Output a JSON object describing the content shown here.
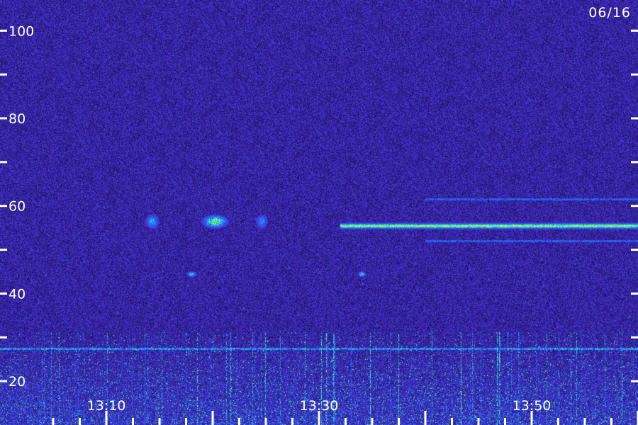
{
  "chart_data": {
    "type": "heatmap",
    "date_label": "06/16",
    "y_ticks": [
      {
        "value": 100,
        "label": "100"
      },
      {
        "value": 90,
        "label": ""
      },
      {
        "value": 80,
        "label": "80"
      },
      {
        "value": 70,
        "label": ""
      },
      {
        "value": 60,
        "label": "60"
      },
      {
        "value": 50,
        "label": ""
      },
      {
        "value": 40,
        "label": "40"
      },
      {
        "value": 30,
        "label": ""
      },
      {
        "value": 20,
        "label": "20"
      }
    ],
    "x_ticks": [
      {
        "minute": 5,
        "label": ""
      },
      {
        "minute": 7.5,
        "label": ""
      },
      {
        "minute": 10,
        "label": "13:10"
      },
      {
        "minute": 12.5,
        "label": ""
      },
      {
        "minute": 15,
        "label": ""
      },
      {
        "minute": 17.5,
        "label": ""
      },
      {
        "minute": 20,
        "label": ""
      },
      {
        "minute": 22.5,
        "label": ""
      },
      {
        "minute": 25,
        "label": ""
      },
      {
        "minute": 27.5,
        "label": ""
      },
      {
        "minute": 30,
        "label": "13:30"
      },
      {
        "minute": 32.5,
        "label": ""
      },
      {
        "minute": 35,
        "label": ""
      },
      {
        "minute": 37.5,
        "label": ""
      },
      {
        "minute": 40,
        "label": ""
      },
      {
        "minute": 42.5,
        "label": ""
      },
      {
        "minute": 45,
        "label": ""
      },
      {
        "minute": 47.5,
        "label": ""
      },
      {
        "minute": 50,
        "label": "13:50"
      },
      {
        "minute": 52.5,
        "label": ""
      },
      {
        "minute": 55,
        "label": ""
      },
      {
        "minute": 57.5,
        "label": ""
      },
      {
        "minute": 60,
        "label": ""
      }
    ],
    "y_range": [
      10,
      107
    ],
    "x_range_minutes": [
      0,
      60
    ],
    "colors": {
      "background": "#1a0f5c",
      "noise_low": "#160c4a",
      "noise_high": "#4a2fd0",
      "signal_mid": "#1f6fff",
      "signal_high": "#2bf5c8",
      "signal_peak": "#9bff4a"
    },
    "features": [
      {
        "kind": "band",
        "y": 55.5,
        "x_start": 32,
        "x_end": 60,
        "intensity": 0.85
      },
      {
        "kind": "blob",
        "y": 56.5,
        "x": 14.3,
        "width": 1.2,
        "height": 3,
        "intensity": 0.5
      },
      {
        "kind": "blob",
        "y": 56.5,
        "x": 20.2,
        "width": 2.5,
        "height": 3,
        "intensity": 0.7
      },
      {
        "kind": "blob",
        "y": 56.5,
        "x": 24.6,
        "width": 1,
        "height": 3,
        "intensity": 0.45
      },
      {
        "kind": "blob",
        "y": 44.5,
        "x": 18,
        "width": 0.8,
        "height": 1,
        "intensity": 0.6
      },
      {
        "kind": "blob",
        "y": 44.5,
        "x": 34,
        "width": 0.6,
        "height": 1,
        "intensity": 0.6
      },
      {
        "kind": "line",
        "y": 27.5,
        "x_start": 0,
        "x_end": 60,
        "intensity": 0.75
      },
      {
        "kind": "line",
        "y": 61.5,
        "x_start": 40,
        "x_end": 60,
        "intensity": 0.3
      },
      {
        "kind": "line",
        "y": 52,
        "x_start": 40,
        "x_end": 60,
        "intensity": 0.3
      }
    ]
  }
}
